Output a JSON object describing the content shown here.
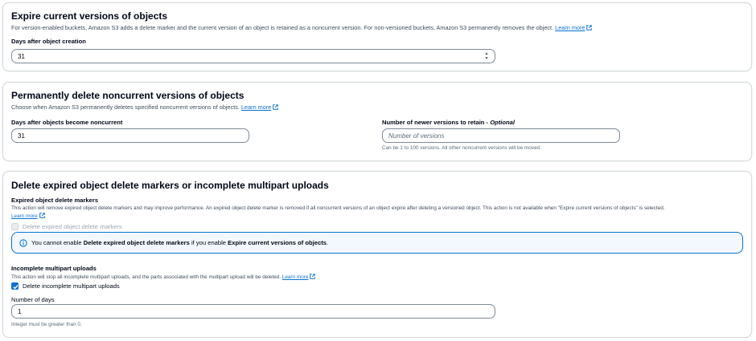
{
  "expire_current": {
    "title": "Expire current versions of objects",
    "description": "For version-enabled buckets, Amazon S3 adds a delete marker and the current version of an object is retained as a noncurrent version. For non-versioned buckets, Amazon S3 permanently removes the object.",
    "learn_more": "Learn more",
    "days_label": "Days after object creation",
    "days_value": "31"
  },
  "delete_noncurrent": {
    "title": "Permanently delete noncurrent versions of objects",
    "description": "Choose when Amazon S3 permanently deletes specified noncurrent versions of objects.",
    "learn_more": "Learn more",
    "days_label": "Days after objects become noncurrent",
    "days_value": "31",
    "versions_label": "Number of newer versions to retain - ",
    "versions_optional": "Optional",
    "versions_placeholder": "Number of versions",
    "versions_hint": "Can be 1 to 100 versions. All other noncurrent versions will be moved."
  },
  "delete_markers": {
    "title": "Delete expired object delete markers or incomplete multipart uploads",
    "markers_heading": "Expired object delete markers",
    "markers_description": "This action will remove expired object delete markers and may improve performance. An expired object delete marker is removed if all noncurrent versions of an object expire after deleting a versioned object. This action is not available when \"Expire current versions of objects\" is selected.",
    "learn_more": "Learn more",
    "markers_checkbox_label": "Delete expired object delete markers",
    "alert_pre": "You cannot enable ",
    "alert_bold1": "Delete expired object delete markers",
    "alert_mid": " if you enable ",
    "alert_bold2": "Expire current versions of objects",
    "alert_post": ".",
    "multipart_heading": "Incomplete multipart uploads",
    "multipart_description": "This action will stop all incomplete multipart uploads, and the parts associated with the multipart upload will be deleted.",
    "multipart_checkbox_label": "Delete incomplete multipart uploads",
    "days_label": "Number of days",
    "days_value": "1",
    "days_hint": "Integer must be greater than 0."
  },
  "colors": {
    "link": "#0972d3",
    "alert_bg": "#f2f8fd",
    "border": "#d5dbdb"
  }
}
